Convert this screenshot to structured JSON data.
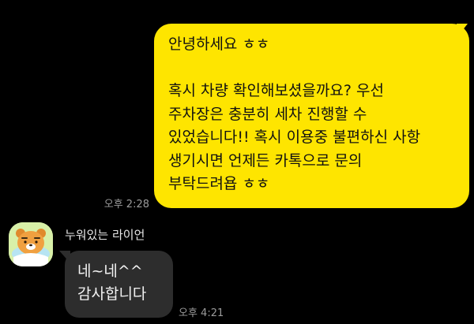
{
  "conversation": {
    "messages": [
      {
        "direction": "sent",
        "lines": [
          "안녕하세요 ㅎㅎ",
          "",
          "혹시 차량 확인해보셨을까요? 우선",
          "주차장은 충분히 세차 진행할 수",
          "있었습니다!! 혹시 이용중 불편하신 사항",
          "생기시면 언제든 카톡으로 문의",
          "부탁드려욥 ㅎㅎ"
        ],
        "time": "오후 2:28"
      },
      {
        "direction": "received",
        "sender": "누워있는 라이언",
        "avatar_icon": "ryan-character-avatar",
        "lines": [
          "네~네^^",
          "감사합니다"
        ],
        "time": "오후 4:21"
      }
    ]
  },
  "colors": {
    "background": "#000000",
    "sent_bubble": "#fee500",
    "received_bubble": "#2d2d2d",
    "timestamp": "#9b9b9b"
  }
}
